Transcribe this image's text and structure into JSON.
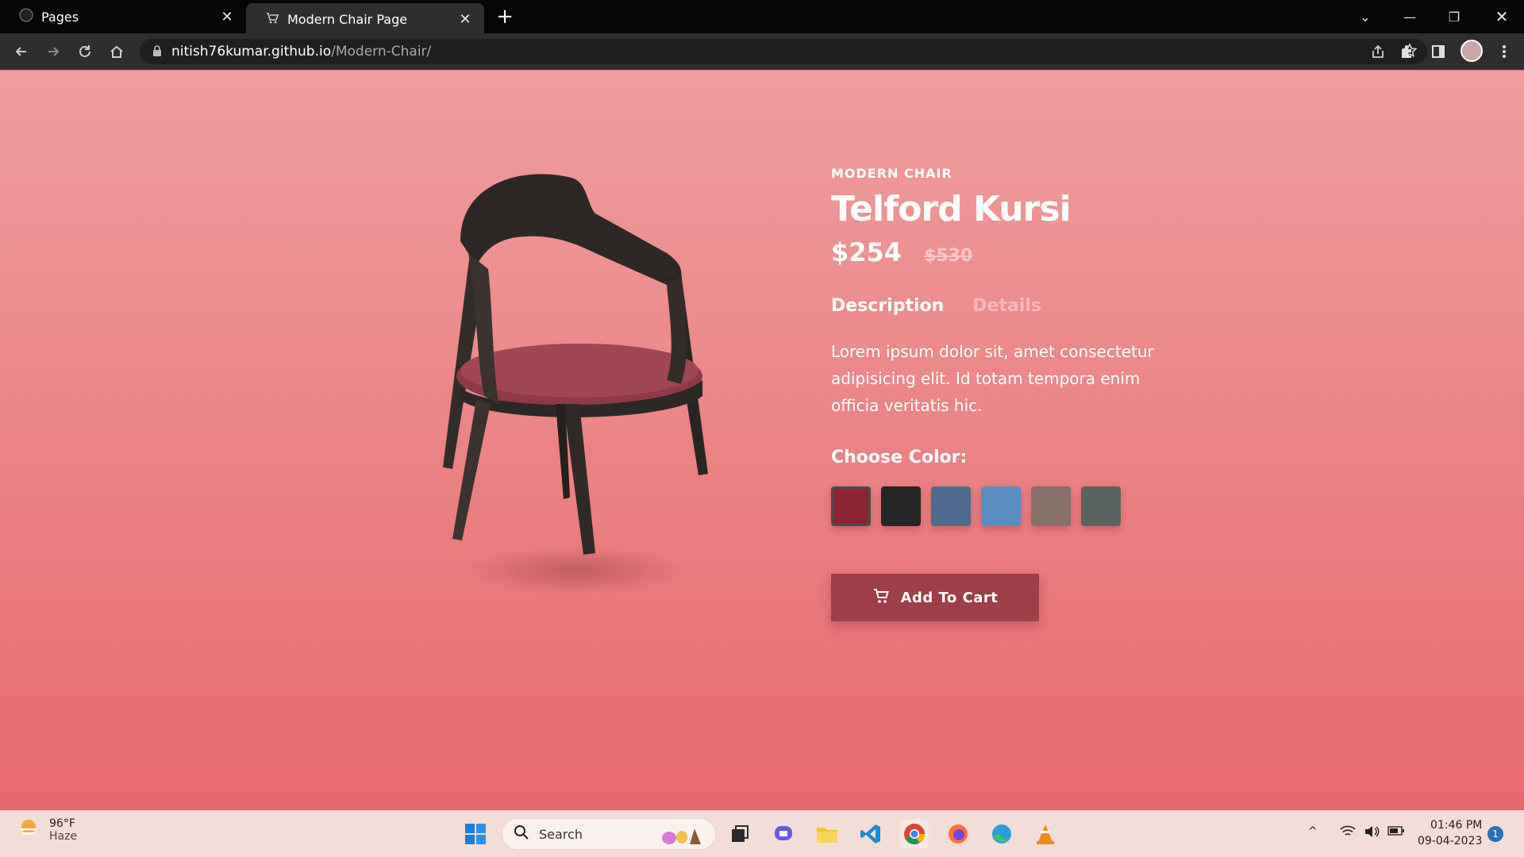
{
  "browser": {
    "tabs": [
      {
        "title": "Pages",
        "icon": "github-icon",
        "active": false
      },
      {
        "title": "Modern Chair Page",
        "icon": "cart-favicon-icon",
        "active": true
      }
    ],
    "new_tab": "+",
    "url_host": "nitish76kumar.github.io",
    "url_path": "/Modern-Chair/"
  },
  "product": {
    "eyebrow": "MODERN CHAIR",
    "title": "Telford Kursi",
    "price": "$254",
    "old_price": "$530",
    "tabs": [
      "Description",
      "Details"
    ],
    "description": "Lorem ipsum dolor sit, amet consectetur adipisicing elit. Id totam tempora enim officia veritatis hic.",
    "choose_color_label": "Choose Color:",
    "colors": [
      {
        "name": "maroon",
        "hex": "#8c2434",
        "selected": true
      },
      {
        "name": "black",
        "hex": "#262626",
        "selected": false
      },
      {
        "name": "denim",
        "hex": "#4e6a8e",
        "selected": false
      },
      {
        "name": "light-blue",
        "hex": "#5a8ec2",
        "selected": false
      },
      {
        "name": "taupe",
        "hex": "#85706a",
        "selected": false
      },
      {
        "name": "slate",
        "hex": "#5b6360",
        "selected": false
      }
    ],
    "add_to_cart_label": "Add To Cart"
  },
  "taskbar": {
    "weather_temp": "96°F",
    "weather_desc": "Haze",
    "search_label": "Search",
    "time": "01:46 PM",
    "date": "09-04-2023",
    "notification_count": "1"
  },
  "colors": {
    "page_top": "#ef9ea0",
    "page_bottom": "#e8696f",
    "button": "#9e3f4a"
  }
}
